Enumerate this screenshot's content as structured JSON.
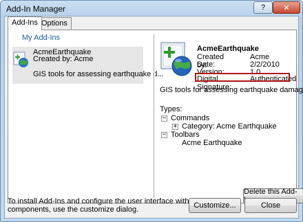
{
  "window": {
    "title": "Add-In Manager"
  },
  "titlebar": {
    "help_label": "?",
    "close_label": "✕"
  },
  "tabs": [
    {
      "label": "Add-Ins"
    },
    {
      "label": "Options"
    }
  ],
  "left": {
    "section_title": "My Add-Ins",
    "item": {
      "name": "AcmeEarthquake",
      "created": "Created by: Acme",
      "description": "GIS tools for assessing earthquake d..."
    }
  },
  "details": {
    "name": "AcmeEarthquake",
    "created_by_label": "Created by:",
    "created_by_value": "Acme",
    "date_label": "Date:",
    "date_value": "2/2/2010",
    "version_label": "Version:",
    "version_value": "1.0",
    "signature_label": "Digital Signature:",
    "signature_value": "Authenticated",
    "description": "GIS tools for assessing earthquake damage.",
    "types_label": "Types:",
    "tree": {
      "commands": "Commands",
      "category": "Category: Acme Earthquake",
      "toolbars": "Toolbars",
      "toolbar_item": "Acme Earthquake"
    },
    "delete_label": "Delete this Add-In"
  },
  "footer": {
    "line1": "To install Add-Ins and configure the user interface with Add-In",
    "line2": "components, use the customize dialog.",
    "customize_label": "Customize...",
    "close_label": "Close"
  },
  "colors": {
    "section_title": "#1e5aa8",
    "highlight_box": "#b01414"
  }
}
